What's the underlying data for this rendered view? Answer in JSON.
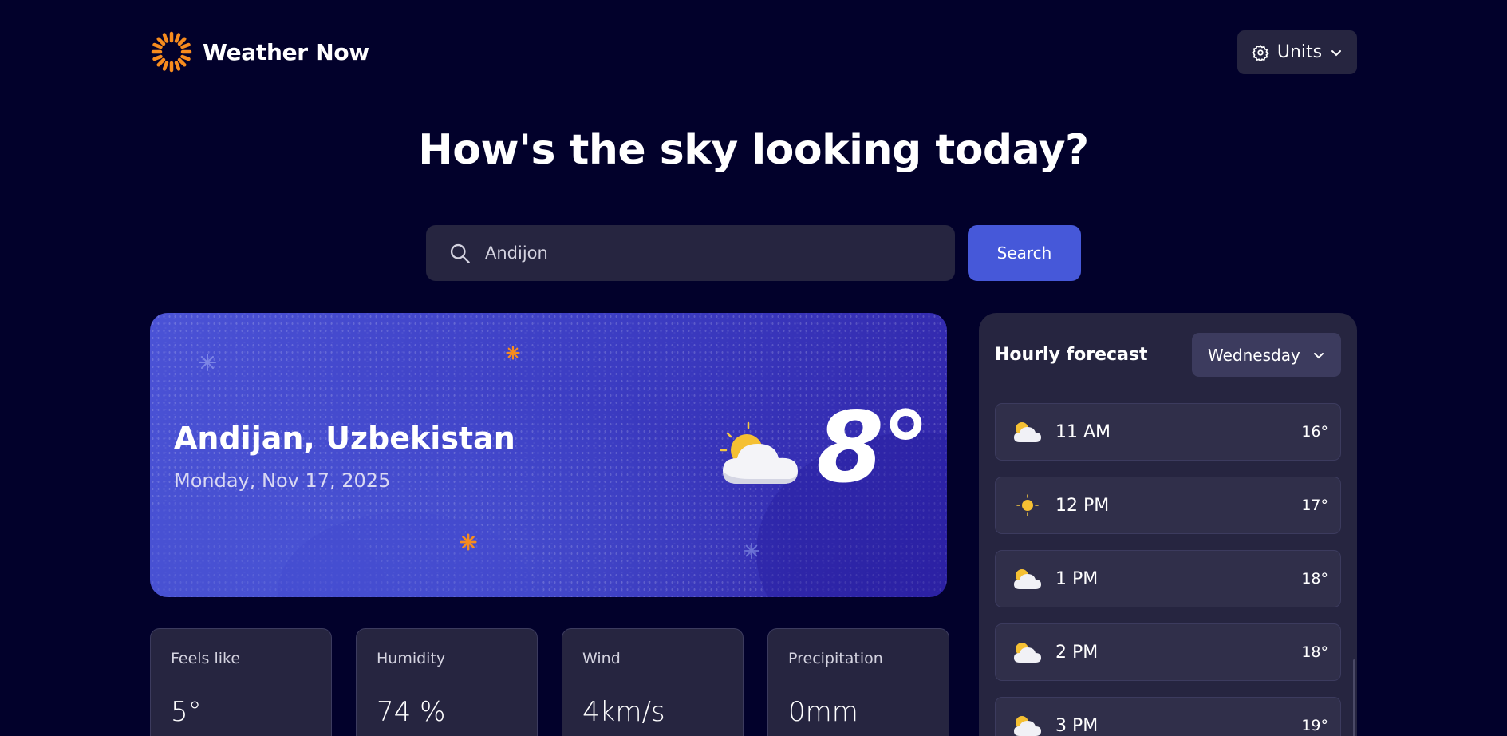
{
  "header": {
    "logo_text": "Weather Now",
    "logo_icon": "sun-icon",
    "units_label": "Units"
  },
  "headline": "How's the sky looking today?",
  "search": {
    "value": "Andijon",
    "button_label": "Search"
  },
  "current": {
    "location": "Andijan, Uzbekistan",
    "date": "Monday, Nov 17, 2025",
    "temperature": "8°",
    "icon": "partly-cloudy-icon"
  },
  "stats": [
    {
      "label": "Feels like",
      "value": "5°"
    },
    {
      "label": "Humidity",
      "value": "74 %"
    },
    {
      "label": "Wind",
      "value": "4km/s"
    },
    {
      "label": "Precipitation",
      "value": "0mm"
    }
  ],
  "hourly": {
    "title": "Hourly forecast",
    "day": "Wednesday",
    "items": [
      {
        "time": "11 AM",
        "temp": "16°",
        "icon": "partly-cloudy-icon"
      },
      {
        "time": "12 PM",
        "temp": "17°",
        "icon": "sun-icon"
      },
      {
        "time": "1 PM",
        "temp": "18°",
        "icon": "partly-cloudy-icon"
      },
      {
        "time": "2 PM",
        "temp": "18°",
        "icon": "partly-cloudy-icon"
      },
      {
        "time": "3 PM",
        "temp": "19°",
        "icon": "partly-cloudy-icon"
      }
    ]
  },
  "colors": {
    "background": "#02012b",
    "card": "#262540",
    "accent": "#4658d9",
    "logo_orange": "#f78c1e"
  }
}
